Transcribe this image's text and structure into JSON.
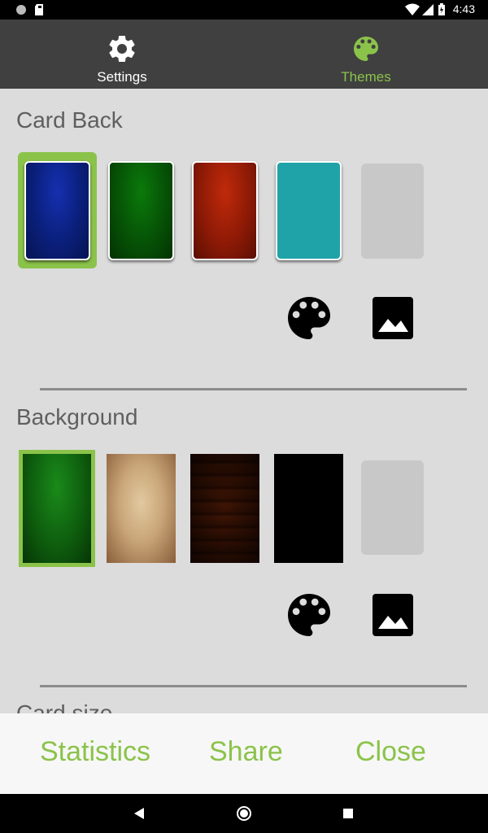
{
  "status_bar": {
    "time": "4:43"
  },
  "tabs": [
    {
      "label": "Settings",
      "icon": "gear-icon",
      "color": "#ffffff"
    },
    {
      "label": "Themes",
      "icon": "palette-icon",
      "color": "#8bc34a"
    }
  ],
  "sections": {
    "card_back": {
      "title": "Card Back",
      "swatches": [
        "blue",
        "green",
        "red",
        "teal",
        "custom"
      ]
    },
    "background": {
      "title": "Background",
      "swatches": [
        "green",
        "parchment",
        "wood",
        "black",
        "custom"
      ]
    },
    "card_size": {
      "title": "Card size"
    }
  },
  "bottom_actions": {
    "statistics": "Statistics",
    "share": "Share",
    "close": "Close"
  },
  "colors": {
    "accent": "#8bc34a",
    "tab_bar": "#404040",
    "content_bg": "#dcdcdc"
  }
}
